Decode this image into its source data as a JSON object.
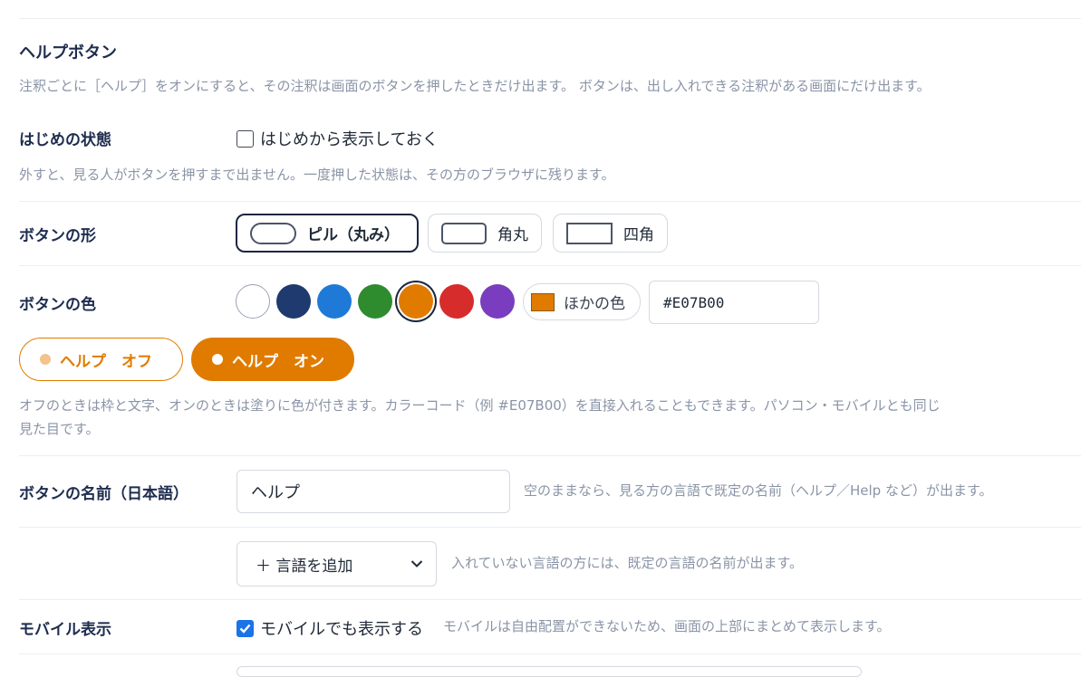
{
  "section": {
    "title": "ヘルプボタン",
    "description": "注釈ごとに［ヘルプ］をオンにすると、その注釈は画面のボタンを押したときだけ出ます。 ボタンは、出し入れできる注釈がある画面にだけ出ます。"
  },
  "initial_state": {
    "label": "はじめの状態",
    "checkbox_label": "はじめから表示しておく",
    "checked": false,
    "hint": "外すと、見る人がボタンを押すまで出ません。一度押した状態は、その方のブラウザに残ります。"
  },
  "shape": {
    "label": "ボタンの形",
    "options": [
      {
        "label": "ピル（丸み）",
        "selected": true
      },
      {
        "label": "角丸",
        "selected": false
      },
      {
        "label": "四角",
        "selected": false
      }
    ]
  },
  "color": {
    "label": "ボタンの色",
    "swatches": [
      {
        "name": "white",
        "hex": "#ffffff"
      },
      {
        "name": "navy",
        "hex": "#1e3a6e"
      },
      {
        "name": "blue",
        "hex": "#1e7ad6"
      },
      {
        "name": "green",
        "hex": "#2e8b2e"
      },
      {
        "name": "orange",
        "hex": "#e07b00",
        "selected": true
      },
      {
        "name": "red",
        "hex": "#d62c2c"
      },
      {
        "name": "purple",
        "hex": "#7a3dbf"
      }
    ],
    "other_label": "ほかの色",
    "other_swatch": "#e07b00",
    "hex_value": "#E07B00",
    "preview_off": "ヘルプ　オフ",
    "preview_on": "ヘルプ　オン",
    "hint_line1": "オフのときは枠と文字、オンのときは塗りに色が付きます。カラーコード（例 #E07B00）を直接入れることもできます。パソコン・モバイルとも同じ",
    "hint_line2": "見た目です。"
  },
  "button_name": {
    "label": "ボタンの名前（日本語）",
    "value": "ヘルプ",
    "hint": "空のままなら、見る方の言語で既定の名前（ヘルプ／Help など）が出ます。"
  },
  "language": {
    "select_label": "＋ 言語を追加",
    "hint": "入れていない言語の方には、既定の言語の名前が出ます。"
  },
  "mobile": {
    "label": "モバイル表示",
    "checkbox_label": "モバイルでも表示する",
    "checked": true,
    "hint": "モバイルは自由配置ができないため、画面の上部にまとめて表示します。"
  }
}
